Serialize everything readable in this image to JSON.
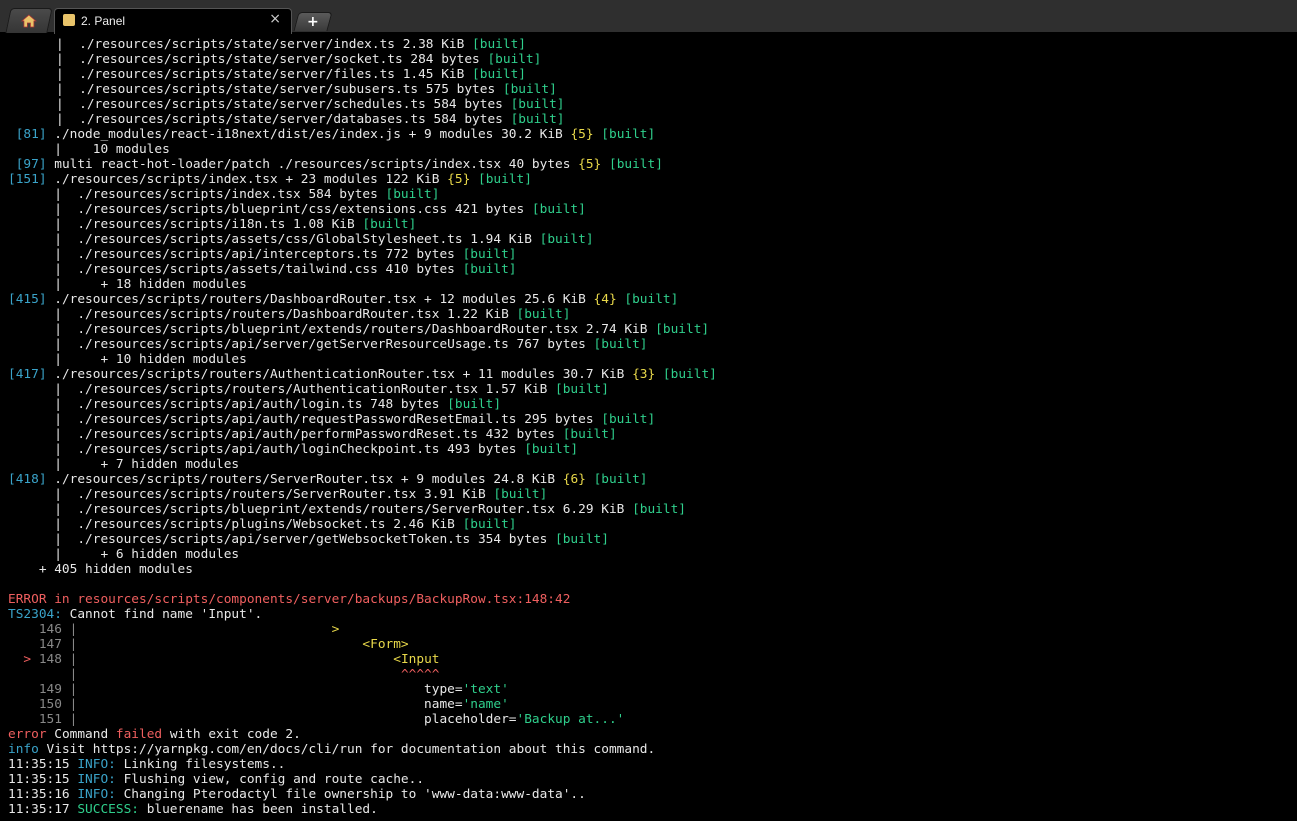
{
  "tabs": {
    "home_icon": "home-icon",
    "active": {
      "label": "2. Panel",
      "close": "×"
    },
    "new_tab": "+"
  },
  "terminal": {
    "lines": [
      [
        [
          "|  ./resources/scripts/state/server/index.ts 2.38 KiB ",
          "c-default"
        ],
        [
          "[built]",
          "c-green"
        ]
      ],
      [
        [
          "|  ./resources/scripts/state/server/socket.ts 284 bytes ",
          "c-default"
        ],
        [
          "[built]",
          "c-green"
        ]
      ],
      [
        [
          "|  ./resources/scripts/state/server/files.ts 1.45 KiB ",
          "c-default"
        ],
        [
          "[built]",
          "c-green"
        ]
      ],
      [
        [
          "|  ./resources/scripts/state/server/subusers.ts 575 bytes ",
          "c-default"
        ],
        [
          "[built]",
          "c-green"
        ]
      ],
      [
        [
          "|  ./resources/scripts/state/server/schedules.ts 584 bytes ",
          "c-default"
        ],
        [
          "[built]",
          "c-green"
        ]
      ],
      [
        [
          "|  ./resources/scripts/state/server/databases.ts 584 bytes ",
          "c-default"
        ],
        [
          "[built]",
          "c-green"
        ]
      ],
      [
        [
          " [81] ",
          "c-cyan"
        ],
        [
          "./node_modules/react-i18next/dist/es/index.js + 9 modules 30.2 KiB ",
          "c-default"
        ],
        [
          "{5}",
          "c-yellow"
        ],
        [
          " ",
          "c-default"
        ],
        [
          "[built]",
          "c-green"
        ]
      ],
      [
        [
          "      |    10 modules",
          "c-default"
        ]
      ],
      [
        [
          " [97] ",
          "c-cyan"
        ],
        [
          "multi react-hot-loader/patch ./resources/scripts/index.tsx 40 bytes ",
          "c-default"
        ],
        [
          "{5}",
          "c-yellow"
        ],
        [
          " ",
          "c-default"
        ],
        [
          "[built]",
          "c-green"
        ]
      ],
      [
        [
          "[151] ",
          "c-cyan"
        ],
        [
          "./resources/scripts/index.tsx + 23 modules 122 KiB ",
          "c-default"
        ],
        [
          "{5}",
          "c-yellow"
        ],
        [
          " ",
          "c-default"
        ],
        [
          "[built]",
          "c-green"
        ]
      ],
      [
        [
          "      |  ./resources/scripts/index.tsx 584 bytes ",
          "c-default"
        ],
        [
          "[built]",
          "c-green"
        ]
      ],
      [
        [
          "      |  ./resources/scripts/blueprint/css/extensions.css 421 bytes ",
          "c-default"
        ],
        [
          "[built]",
          "c-green"
        ]
      ],
      [
        [
          "      |  ./resources/scripts/i18n.ts 1.08 KiB ",
          "c-default"
        ],
        [
          "[built]",
          "c-green"
        ]
      ],
      [
        [
          "      |  ./resources/scripts/assets/css/GlobalStylesheet.ts 1.94 KiB ",
          "c-default"
        ],
        [
          "[built]",
          "c-green"
        ]
      ],
      [
        [
          "      |  ./resources/scripts/api/interceptors.ts 772 bytes ",
          "c-default"
        ],
        [
          "[built]",
          "c-green"
        ]
      ],
      [
        [
          "      |  ./resources/scripts/assets/tailwind.css 410 bytes ",
          "c-default"
        ],
        [
          "[built]",
          "c-green"
        ]
      ],
      [
        [
          "      |     + 18 hidden modules",
          "c-default"
        ]
      ],
      [
        [
          "[415] ",
          "c-cyan"
        ],
        [
          "./resources/scripts/routers/DashboardRouter.tsx + 12 modules 25.6 KiB ",
          "c-default"
        ],
        [
          "{4}",
          "c-yellow"
        ],
        [
          " ",
          "c-default"
        ],
        [
          "[built]",
          "c-green"
        ]
      ],
      [
        [
          "      |  ./resources/scripts/routers/DashboardRouter.tsx 1.22 KiB ",
          "c-default"
        ],
        [
          "[built]",
          "c-green"
        ]
      ],
      [
        [
          "      |  ./resources/scripts/blueprint/extends/routers/DashboardRouter.tsx 2.74 KiB ",
          "c-default"
        ],
        [
          "[built]",
          "c-green"
        ]
      ],
      [
        [
          "      |  ./resources/scripts/api/server/getServerResourceUsage.ts 767 bytes ",
          "c-default"
        ],
        [
          "[built]",
          "c-green"
        ]
      ],
      [
        [
          "      |     + 10 hidden modules",
          "c-default"
        ]
      ],
      [
        [
          "[417] ",
          "c-cyan"
        ],
        [
          "./resources/scripts/routers/AuthenticationRouter.tsx + 11 modules 30.7 KiB ",
          "c-default"
        ],
        [
          "{3}",
          "c-yellow"
        ],
        [
          " ",
          "c-default"
        ],
        [
          "[built]",
          "c-green"
        ]
      ],
      [
        [
          "      |  ./resources/scripts/routers/AuthenticationRouter.tsx 1.57 KiB ",
          "c-default"
        ],
        [
          "[built]",
          "c-green"
        ]
      ],
      [
        [
          "      |  ./resources/scripts/api/auth/login.ts 748 bytes ",
          "c-default"
        ],
        [
          "[built]",
          "c-green"
        ]
      ],
      [
        [
          "      |  ./resources/scripts/api/auth/requestPasswordResetEmail.ts 295 bytes ",
          "c-default"
        ],
        [
          "[built]",
          "c-green"
        ]
      ],
      [
        [
          "      |  ./resources/scripts/api/auth/performPasswordReset.ts 432 bytes ",
          "c-default"
        ],
        [
          "[built]",
          "c-green"
        ]
      ],
      [
        [
          "      |  ./resources/scripts/api/auth/loginCheckpoint.ts 493 bytes ",
          "c-default"
        ],
        [
          "[built]",
          "c-green"
        ]
      ],
      [
        [
          "      |     + 7 hidden modules",
          "c-default"
        ]
      ],
      [
        [
          "[418] ",
          "c-cyan"
        ],
        [
          "./resources/scripts/routers/ServerRouter.tsx + 9 modules 24.8 KiB ",
          "c-default"
        ],
        [
          "{6}",
          "c-yellow"
        ],
        [
          " ",
          "c-default"
        ],
        [
          "[built]",
          "c-green"
        ]
      ],
      [
        [
          "      |  ./resources/scripts/routers/ServerRouter.tsx 3.91 KiB ",
          "c-default"
        ],
        [
          "[built]",
          "c-green"
        ]
      ],
      [
        [
          "      |  ./resources/scripts/blueprint/extends/routers/ServerRouter.tsx 6.29 KiB ",
          "c-default"
        ],
        [
          "[built]",
          "c-green"
        ]
      ],
      [
        [
          "      |  ./resources/scripts/plugins/Websocket.ts 2.46 KiB ",
          "c-default"
        ],
        [
          "[built]",
          "c-green"
        ]
      ],
      [
        [
          "      |  ./resources/scripts/api/server/getWebsocketToken.ts 354 bytes ",
          "c-default"
        ],
        [
          "[built]",
          "c-green"
        ]
      ],
      [
        [
          "      |     + 6 hidden modules",
          "c-default"
        ]
      ],
      [
        [
          "    + 405 hidden modules",
          "c-default"
        ]
      ],
      [
        [
          "",
          "c-default"
        ]
      ],
      [
        [
          "ERROR in resources/scripts/components/server/backups/BackupRow.tsx:148:42",
          "c-red"
        ]
      ],
      [
        [
          "TS2304: ",
          "c-cyan"
        ],
        [
          "Cannot find name 'Input'.",
          "c-default"
        ]
      ],
      [
        [
          "    146 | ",
          "c-gray"
        ],
        [
          "                                ",
          "c-default"
        ],
        [
          ">",
          "c-yellow"
        ]
      ],
      [
        [
          "    147 | ",
          "c-gray"
        ],
        [
          "                                    ",
          "c-default"
        ],
        [
          "<Form>",
          "c-yellow"
        ]
      ],
      [
        [
          "  ",
          "c-default"
        ],
        [
          "> ",
          "c-red"
        ],
        [
          "148 | ",
          "c-gray"
        ],
        [
          "                                        ",
          "c-default"
        ],
        [
          "<Input",
          "c-yellow"
        ]
      ],
      [
        [
          "        | ",
          "c-gray"
        ],
        [
          "                                         ",
          "c-default"
        ],
        [
          "^^^^^",
          "c-red"
        ]
      ],
      [
        [
          "    149 | ",
          "c-gray"
        ],
        [
          "                                            type=",
          "c-default"
        ],
        [
          "'text'",
          "c-green"
        ]
      ],
      [
        [
          "    150 | ",
          "c-gray"
        ],
        [
          "                                            name=",
          "c-default"
        ],
        [
          "'name'",
          "c-green"
        ]
      ],
      [
        [
          "    151 | ",
          "c-gray"
        ],
        [
          "                                            placeholder=",
          "c-default"
        ],
        [
          "'Backup at...'",
          "c-green"
        ]
      ],
      [
        [
          "error ",
          "c-red"
        ],
        [
          "Command ",
          "c-default"
        ],
        [
          "failed",
          "c-red"
        ],
        [
          " with exit code 2.",
          "c-default"
        ]
      ],
      [
        [
          "info ",
          "c-info"
        ],
        [
          "Visit https://yarnpkg.com/en/docs/cli/run for documentation about this command.",
          "c-default"
        ]
      ],
      [
        [
          "11:35:15 ",
          "c-default"
        ],
        [
          "INFO:",
          "c-info"
        ],
        [
          " Linking filesystems..",
          "c-default"
        ]
      ],
      [
        [
          "11:35:15 ",
          "c-default"
        ],
        [
          "INFO:",
          "c-info"
        ],
        [
          " Flushing view, config and route cache..",
          "c-default"
        ]
      ],
      [
        [
          "11:35:16 ",
          "c-default"
        ],
        [
          "INFO:",
          "c-info"
        ],
        [
          " Changing Pterodactyl file ownership to 'www-data:www-data'..",
          "c-default"
        ]
      ],
      [
        [
          "11:35:17 ",
          "c-default"
        ],
        [
          "SUCCESS:",
          "c-green"
        ],
        [
          " bluerename has been installed.",
          "c-default"
        ]
      ]
    ]
  }
}
